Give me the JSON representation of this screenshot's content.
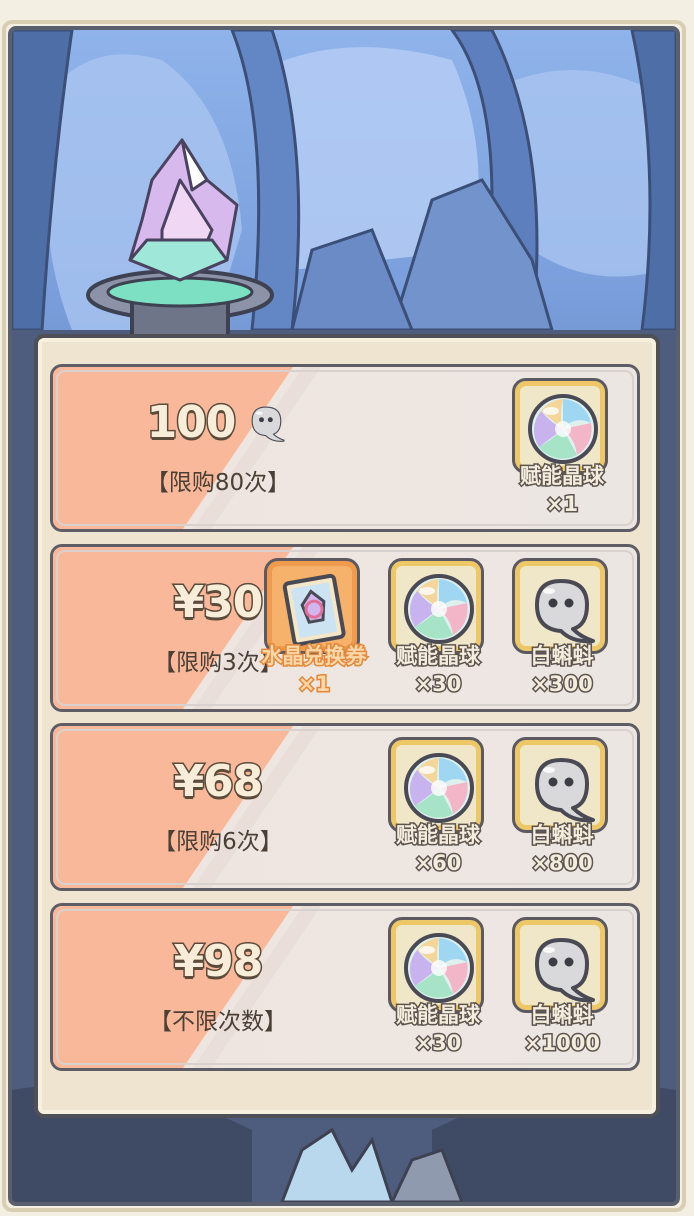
{
  "offers": [
    {
      "price": "100",
      "price_icon": "white-tadpole-icon",
      "limit": "【限购80次】",
      "items": [
        {
          "icon": "energy-crystal-orb-icon",
          "name": "赋能晶球",
          "qty": "×1"
        }
      ]
    },
    {
      "price": "¥30",
      "limit": "【限购3次】",
      "items": [
        {
          "icon": "crystal-voucher-icon",
          "name": "水晶兑换券",
          "qty": "×1",
          "highlight": true
        },
        {
          "icon": "energy-crystal-orb-icon",
          "name": "赋能晶球",
          "qty": "×30"
        },
        {
          "icon": "white-tadpole-icon",
          "name": "白蝌蚪",
          "qty": "×300"
        }
      ]
    },
    {
      "price": "¥68",
      "limit": "【限购6次】",
      "items": [
        {
          "icon": "energy-crystal-orb-icon",
          "name": "赋能晶球",
          "qty": "×60"
        },
        {
          "icon": "white-tadpole-icon",
          "name": "白蝌蚪",
          "qty": "×800"
        }
      ]
    },
    {
      "price": "¥98",
      "limit": "【不限次数】",
      "items": [
        {
          "icon": "energy-crystal-orb-icon",
          "name": "赋能晶球",
          "qty": "×30"
        },
        {
          "icon": "white-tadpole-icon",
          "name": "白蝌蚪",
          "qty": "×1000"
        }
      ]
    }
  ],
  "colors": {
    "stripe": "#f9b89a",
    "panel": "#eee4cf",
    "text_outline": "#5c4a3b",
    "slot_gold": "#eec867",
    "slot_orange": "#f6b26a"
  }
}
